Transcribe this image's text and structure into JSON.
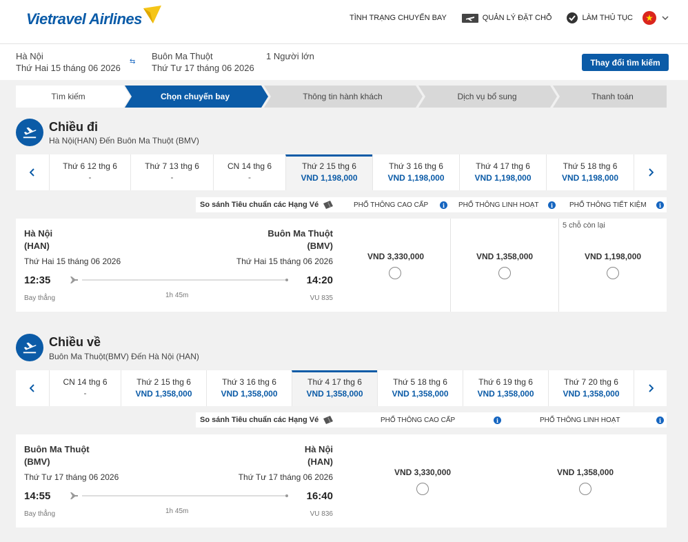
{
  "brand": {
    "name": "Vietravel Airlines",
    "accent": "#0b5ba7",
    "flag_color": "#f5c518"
  },
  "nav": {
    "flight_status": "TÌNH TRẠNG CHUYẾN BAY",
    "manage_booking": "QUẢN LÝ ĐẶT CHỖ",
    "check_in": "LÀM THỦ TỤC",
    "language_flag": "vietnam-flag-icon"
  },
  "search": {
    "origin": "Hà Nội",
    "origin_date": "Thứ Hai 15 tháng 06 2026",
    "destination": "Buôn Ma Thuột",
    "destination_date": "Thứ Tư 17 tháng 06 2026",
    "passengers": "1 Người lớn",
    "change_button": "Thay đổi tìm kiếm"
  },
  "steps": [
    "Tìm kiếm",
    "Chọn chuyến bay",
    "Thông tin hành khách",
    "Dịch vụ bổ sung",
    "Thanh toán"
  ],
  "outbound": {
    "title": "Chiều đi",
    "subtitle": "Hà Nội(HAN) Đến Buôn Ma Thuột (BMV)",
    "dates": [
      {
        "day": "Thứ 6 12 thg 6",
        "price": "-"
      },
      {
        "day": "Thứ 7 13 thg 6",
        "price": "-"
      },
      {
        "day": "CN 14 thg 6",
        "price": "-"
      },
      {
        "day": "Thứ 2 15 thg 6",
        "price": "VND 1,198,000"
      },
      {
        "day": "Thứ 3 16 thg 6",
        "price": "VND 1,198,000"
      },
      {
        "day": "Thứ 4 17 thg 6",
        "price": "VND 1,198,000"
      },
      {
        "day": "Thứ 5 18 thg 6",
        "price": "VND 1,198,000"
      }
    ],
    "compare_label": "So sánh Tiêu chuẩn các Hạng Vé",
    "fare_classes": [
      "PHỔ THÔNG CAO CẤP",
      "PHỔ THÔNG LINH HOẠT",
      "PHỔ THÔNG TIẾT KIỆM"
    ],
    "flight": {
      "from_city": "Hà Nội",
      "from_code": "(HAN)",
      "from_date": "Thứ Hai 15 tháng 06 2026",
      "to_city": "Buôn Ma Thuột",
      "to_code": "(BMV)",
      "to_date": "Thứ Hai 15 tháng 06 2026",
      "depart": "12:35",
      "arrive": "14:20",
      "type": "Bay thẳng",
      "duration": "1h 45m",
      "number": "VU 835"
    },
    "fares": [
      "VND 3,330,000",
      "VND 1,358,000",
      "VND 1,198,000"
    ],
    "seats_left": "5 chỗ còn lại"
  },
  "inbound": {
    "title": "Chiều về",
    "subtitle": "Buôn Ma Thuột(BMV) Đến Hà Nội (HAN)",
    "dates": [
      {
        "day": "CN 14 thg 6",
        "price": "-"
      },
      {
        "day": "Thứ 2 15 thg 6",
        "price": "VND 1,358,000"
      },
      {
        "day": "Thứ 3 16 thg 6",
        "price": "VND 1,358,000"
      },
      {
        "day": "Thứ 4 17 thg 6",
        "price": "VND 1,358,000"
      },
      {
        "day": "Thứ 5 18 thg 6",
        "price": "VND 1,358,000"
      },
      {
        "day": "Thứ 6 19 thg 6",
        "price": "VND 1,358,000"
      },
      {
        "day": "Thứ 7 20 thg 6",
        "price": "VND 1,358,000"
      }
    ],
    "compare_label": "So sánh Tiêu chuẩn các Hạng Vé",
    "fare_classes": [
      "PHỔ THÔNG CAO CẤP",
      "PHỔ THÔNG LINH HOẠT"
    ],
    "flight": {
      "from_city": "Buôn Ma Thuột",
      "from_code": "(BMV)",
      "from_date": "Thứ Tư 17 tháng 06 2026",
      "to_city": "Hà Nội",
      "to_code": "(HAN)",
      "to_date": "Thứ Tư 17 tháng 06 2026",
      "depart": "14:55",
      "arrive": "16:40",
      "type": "Bay thẳng",
      "duration": "1h 45m",
      "number": "VU 836"
    },
    "fares": [
      "VND 3,330,000",
      "VND 1,358,000"
    ]
  }
}
